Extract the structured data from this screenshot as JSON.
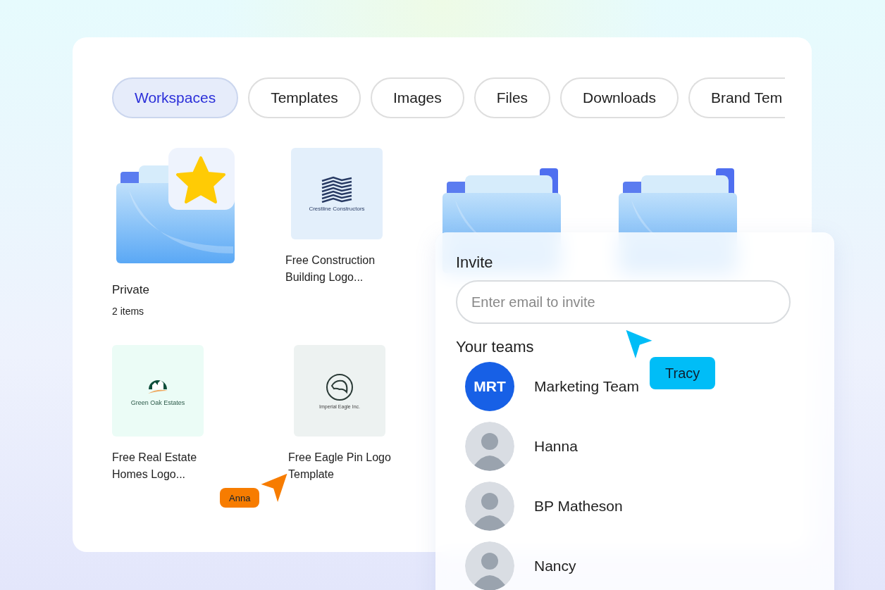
{
  "tabs": [
    {
      "label": "Workspaces",
      "selected": true
    },
    {
      "label": "Templates",
      "selected": false
    },
    {
      "label": "Images",
      "selected": false
    },
    {
      "label": "Files",
      "selected": false
    },
    {
      "label": "Downloads",
      "selected": false
    },
    {
      "label": "Brand Tem",
      "selected": false
    }
  ],
  "items": [
    {
      "kind": "folder",
      "starred": true,
      "title": "Private",
      "subtitle": "2 items"
    },
    {
      "kind": "template",
      "logo": {
        "kind": "buildings",
        "text": "Crestline Constructors"
      },
      "title": "Free Construction Building Logo..."
    },
    {
      "kind": "folder",
      "starred": false
    },
    {
      "kind": "folder",
      "starred": false
    },
    {
      "kind": "template",
      "logo": {
        "kind": "house",
        "text": "Green Oak Estates"
      },
      "title": "Free Real Estate Homes Logo..."
    },
    {
      "kind": "template",
      "logo": {
        "kind": "eagle",
        "text": "Imperial Eagle Inc."
      },
      "title": "Free Eagle Pin Logo Template"
    }
  ],
  "invite": {
    "title": "Invite",
    "placeholder": "Enter email to invite",
    "teams_heading": "Your teams",
    "members": [
      {
        "kind": "team",
        "initials": "MRT",
        "name": "Marketing Team"
      },
      {
        "kind": "person",
        "name": "Hanna"
      },
      {
        "kind": "person",
        "name": "BP Matheson"
      },
      {
        "kind": "person",
        "name": "Nancy"
      }
    ]
  },
  "cursors": [
    {
      "name": "Tracy",
      "color": "#00bdf7"
    },
    {
      "name": "Anna",
      "color": "#f77c00"
    }
  ]
}
